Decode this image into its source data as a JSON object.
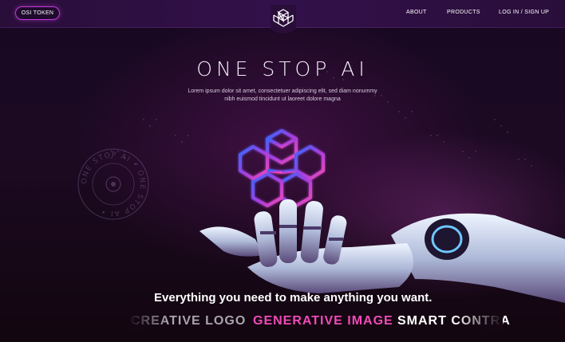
{
  "header": {
    "token_button": "OSI TOKEN",
    "nav": [
      {
        "label": "ABOUT"
      },
      {
        "label": "PRODUCTS"
      },
      {
        "label": "LOG IN / SIGN UP"
      }
    ]
  },
  "hero": {
    "title": "ONE STOP AI",
    "subtitle_line1": "Lorem ipsum dolor sit amet, consectetuer adipiscing elit, sed diam nonummy",
    "subtitle_line2": "nibh euismod tincidunt ut laoreet dolore magna",
    "stamp_text": "ONE STOP AI • ONE STOP AI •",
    "tagline": "Everything you need to make anything you want.",
    "features": [
      {
        "label": "CREATIVE LOGO",
        "color": "#a9a3ad"
      },
      {
        "label": "GENERATIVE IMAGE",
        "color": "#f04ab7"
      },
      {
        "label": "SMART CONTRA",
        "color": "#ffffff"
      }
    ]
  },
  "colors": {
    "accent_pink": "#f04ab7",
    "accent_purple": "#a23ee0",
    "accent_blue": "#2f6bff"
  }
}
